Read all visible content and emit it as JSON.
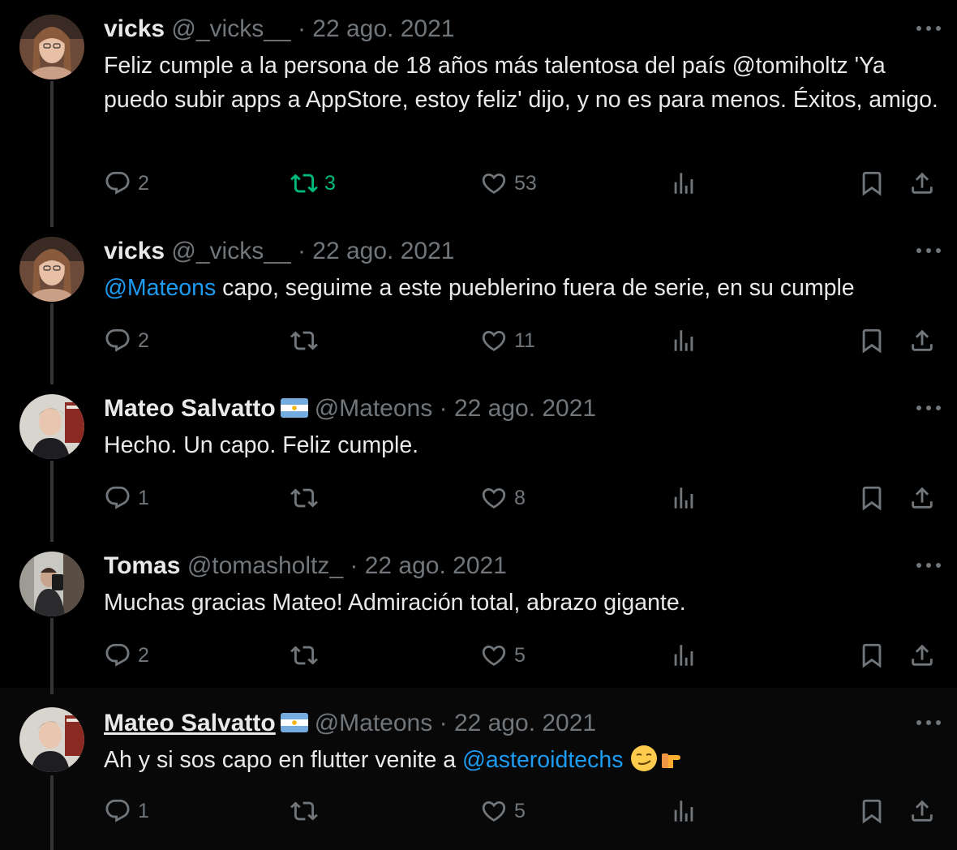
{
  "tweets": [
    {
      "name": "vicks",
      "handle": "@_vicks__",
      "date": "22 ago. 2021",
      "text": "Feliz cumple a la persona de 18 años más talentosa del país @tomiholtz 'Ya puedo subir apps a AppStore, estoy feliz' dijo, y no es para menos. Éxitos, amigo.",
      "replies": "2",
      "retweets": "3",
      "likes": "53"
    },
    {
      "name": "vicks",
      "handle": "@_vicks__",
      "date": "22 ago. 2021",
      "mention": "@Mateons",
      "text": " capo, seguime a este pueblerino fuera de serie, en su cumple",
      "replies": "2",
      "retweets": "",
      "likes": "11"
    },
    {
      "name": "Mateo Salvatto",
      "handle": "@Mateons",
      "date": "22 ago. 2021",
      "text": "Hecho. Un capo. Feliz cumple.",
      "replies": "1",
      "retweets": "",
      "likes": "8"
    },
    {
      "name": "Tomas",
      "handle": "@tomasholtz_",
      "date": "22 ago. 2021",
      "text": "Muchas gracias Mateo! Admiración total, abrazo gigante.",
      "replies": "2",
      "retweets": "",
      "likes": "5"
    },
    {
      "name": "Mateo Salvatto",
      "handle": "@Mateons",
      "date": "22 ago. 2021",
      "text": "Ah y si sos capo en flutter venite a ",
      "mention": "@asteroidtechs",
      "replies": "1",
      "retweets": "",
      "likes": "5"
    }
  ],
  "separator": "·",
  "icons": {
    "reply": "reply-icon",
    "retweet": "retweet-icon",
    "like": "heart-icon",
    "views": "views-icon",
    "bookmark": "bookmark-icon",
    "share": "share-icon",
    "more": "more-icon",
    "flag": "argentina-flag-icon",
    "emoji_1": "smirk-emoji-icon",
    "emoji_2": "pointing-right-emoji-icon"
  },
  "colors": {
    "background": "#000000",
    "text": "#e7e9ea",
    "muted": "#71767b",
    "link": "#1d9bf0",
    "retweet_active": "#00ba7c"
  }
}
